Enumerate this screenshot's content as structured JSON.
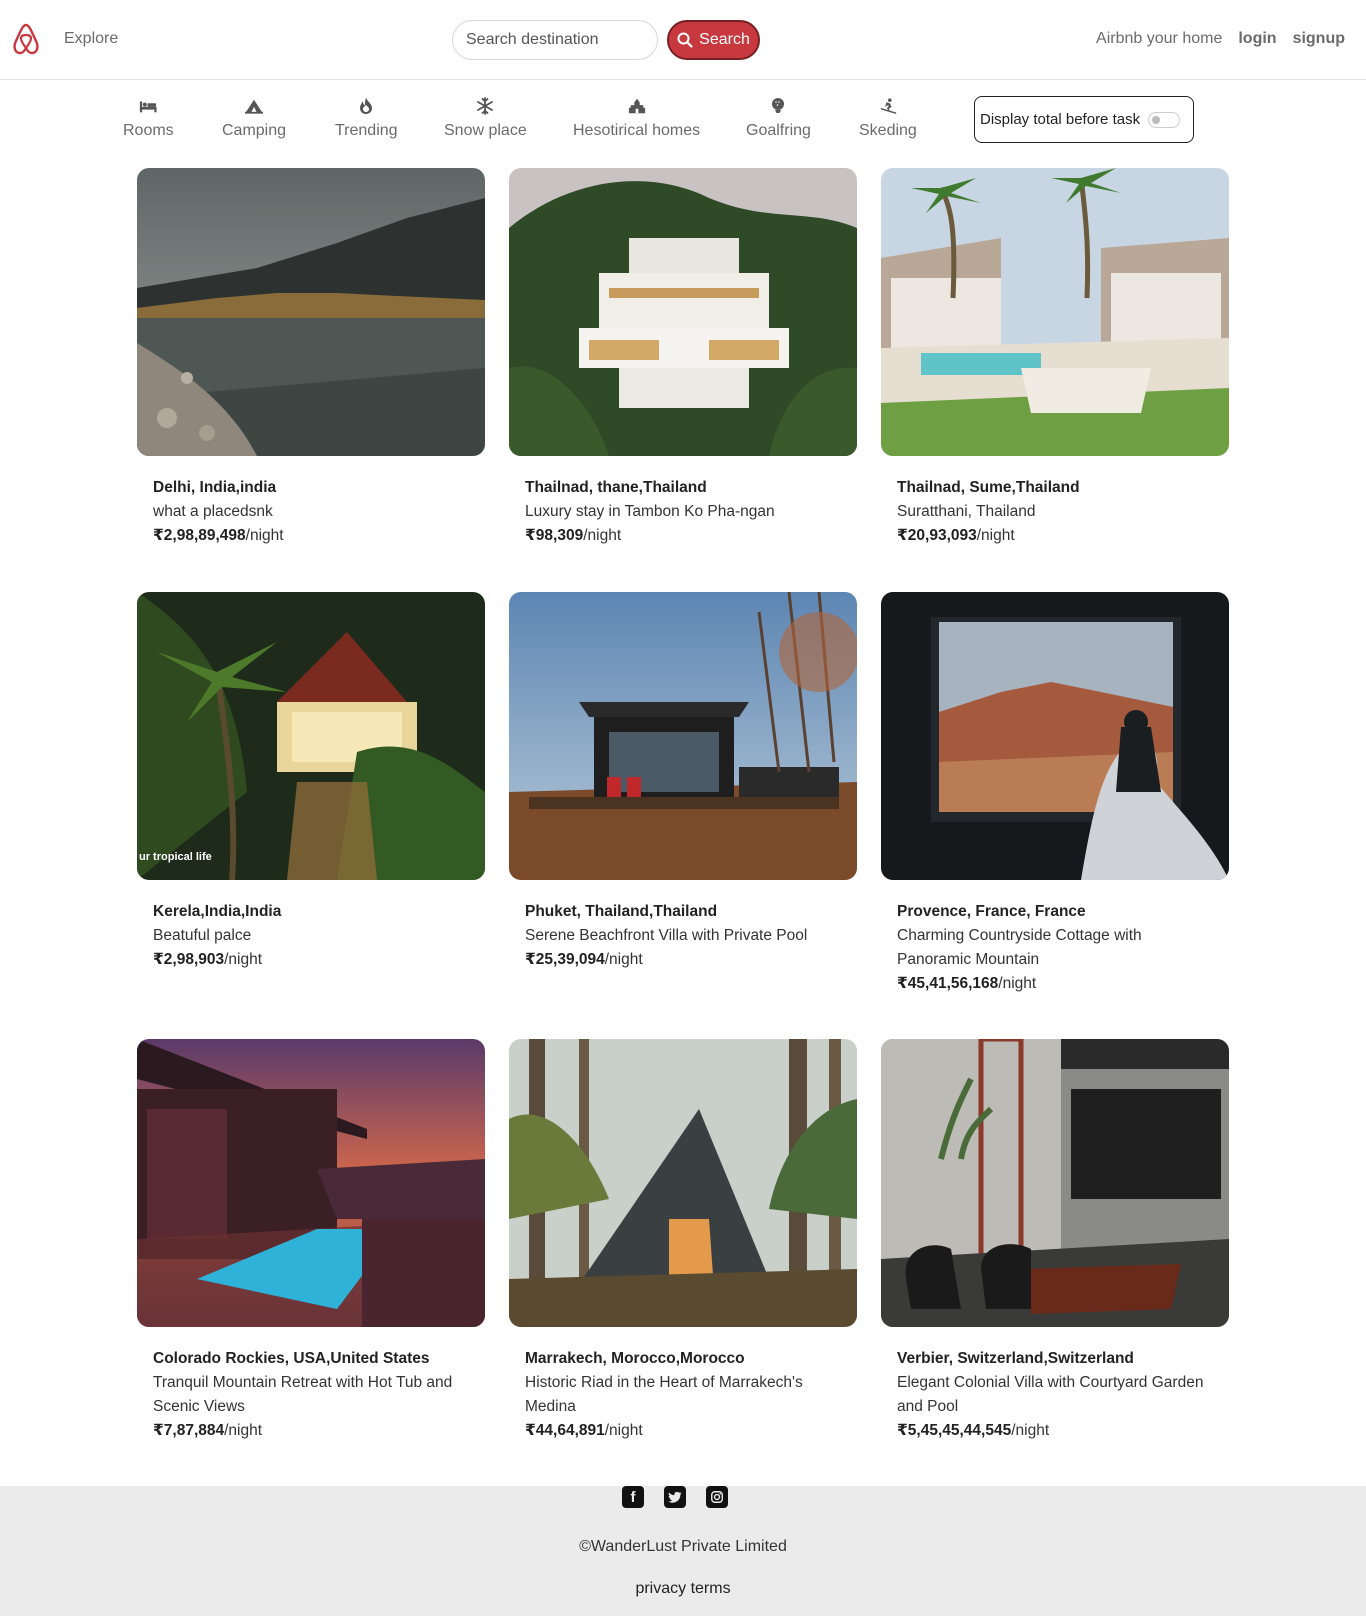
{
  "nav": {
    "explore": "Explore",
    "search_placeholder": "Search destination",
    "search_label": "Search",
    "host": "Airbnb your home",
    "login": "login",
    "signup": "signup"
  },
  "filters": [
    {
      "label": "Rooms",
      "icon": "bed-icon"
    },
    {
      "label": "Camping",
      "icon": "campground-icon"
    },
    {
      "label": "Trending",
      "icon": "fire-icon"
    },
    {
      "label": "Snow place",
      "icon": "snowflake-icon"
    },
    {
      "label": "Hesotirical homes",
      "icon": "monument-icon"
    },
    {
      "label": "Goalfring",
      "icon": "golf-icon"
    },
    {
      "label": "Skeding",
      "icon": "skiing-icon"
    }
  ],
  "tax_toggle": {
    "label": "Display total before task",
    "on": false
  },
  "listings": [
    {
      "title": "Delhi, India,india",
      "desc": "what a placedsnk",
      "price": "₹2,98,89,498",
      "unit": "/night"
    },
    {
      "title": "Thailnad, thane,Thailand",
      "desc": "Luxury stay in Tambon Ko Pha-ngan",
      "price": "₹98,309",
      "unit": "/night"
    },
    {
      "title": "Thailnad, Sume,Thailand",
      "desc": "Suratthani, Thailand",
      "price": "₹20,93,093",
      "unit": "/night"
    },
    {
      "title": "Kerela,India,India",
      "desc": "Beatuful palce",
      "price": "₹2,98,903",
      "unit": "/night",
      "overlay": "ur tropical life"
    },
    {
      "title": "Phuket, Thailand,Thailand",
      "desc": "Serene Beachfront Villa with Private Pool",
      "price": "₹25,39,094",
      "unit": "/night"
    },
    {
      "title": "Provence, France, France",
      "desc": "Charming Countryside Cottage with Panoramic Mountain",
      "price": "₹45,41,56,168",
      "unit": "/night"
    },
    {
      "title": "Colorado Rockies, USA,United States",
      "desc": "Tranquil Mountain Retreat with Hot Tub and Scenic Views",
      "price": "₹7,87,884",
      "unit": "/night"
    },
    {
      "title": "Marrakech, Morocco,Morocco",
      "desc": "Historic Riad in the Heart of Marrakech's Medina",
      "price": "₹44,64,891",
      "unit": "/night"
    },
    {
      "title": "Verbier, Switzerland,Switzerland",
      "desc": "Elegant Colonial Villa with Courtyard Garden and Pool",
      "price": "₹5,45,45,44,545",
      "unit": "/night"
    }
  ],
  "footer": {
    "socials": [
      "facebook-icon",
      "twitter-icon",
      "instagram-icon"
    ],
    "copyright": "©WanderLust Private Limited",
    "policy": "privacy terms"
  }
}
